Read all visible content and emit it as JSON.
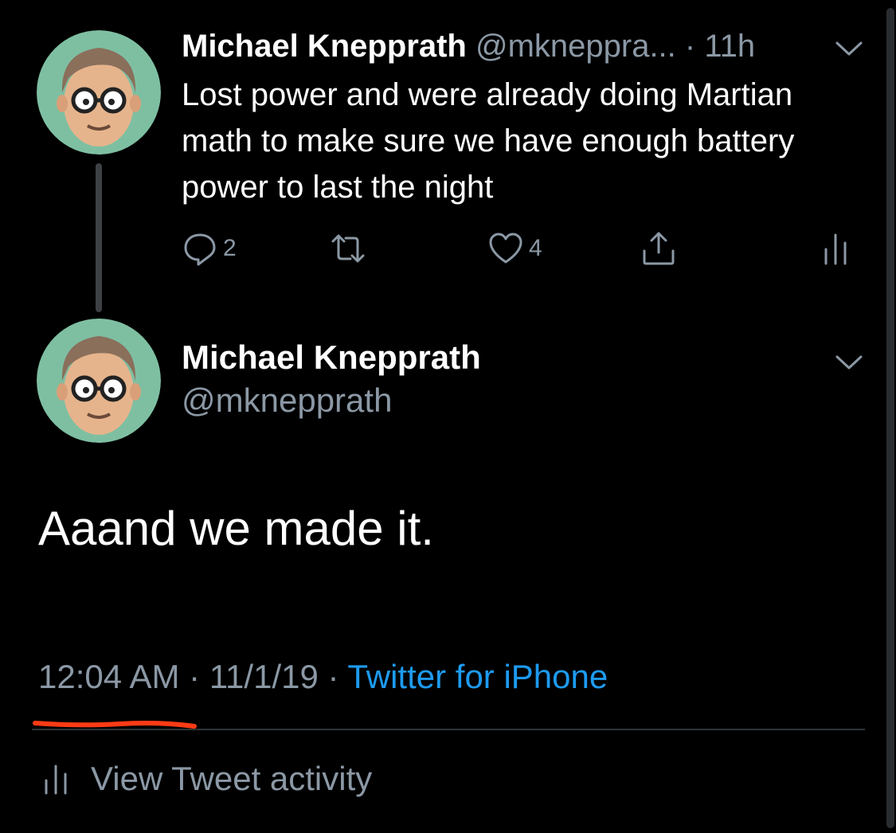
{
  "tweet1": {
    "name": "Michael Knepprath",
    "handle": "@mkneppra...",
    "separator": "·",
    "time": "11h",
    "text": "Lost power and were already doing Martian math to make sure we have enough battery power to last the night",
    "reply_count": "2",
    "like_count": "4"
  },
  "tweet2": {
    "name": "Michael Knepprath",
    "handle": "@mknepprath",
    "text": "Aaand we made it.",
    "time": "12:04 AM",
    "separator": "·",
    "date": "11/1/19",
    "separator2": "·",
    "source": "Twitter for iPhone"
  },
  "footer": {
    "activity_label": "View Tweet activity"
  },
  "icons": {
    "avatar": "bitmoji-avatar",
    "reply": "reply-icon",
    "retweet": "retweet-icon",
    "like": "heart-icon",
    "share": "share-icon",
    "analytics": "analytics-icon",
    "more": "chevron-down-icon"
  },
  "colors": {
    "background": "#000000",
    "muted_text": "#8b98a5",
    "link": "#1d9bf0",
    "avatar_bg": "#7ebfa2",
    "annotation": "#ff3b14"
  }
}
